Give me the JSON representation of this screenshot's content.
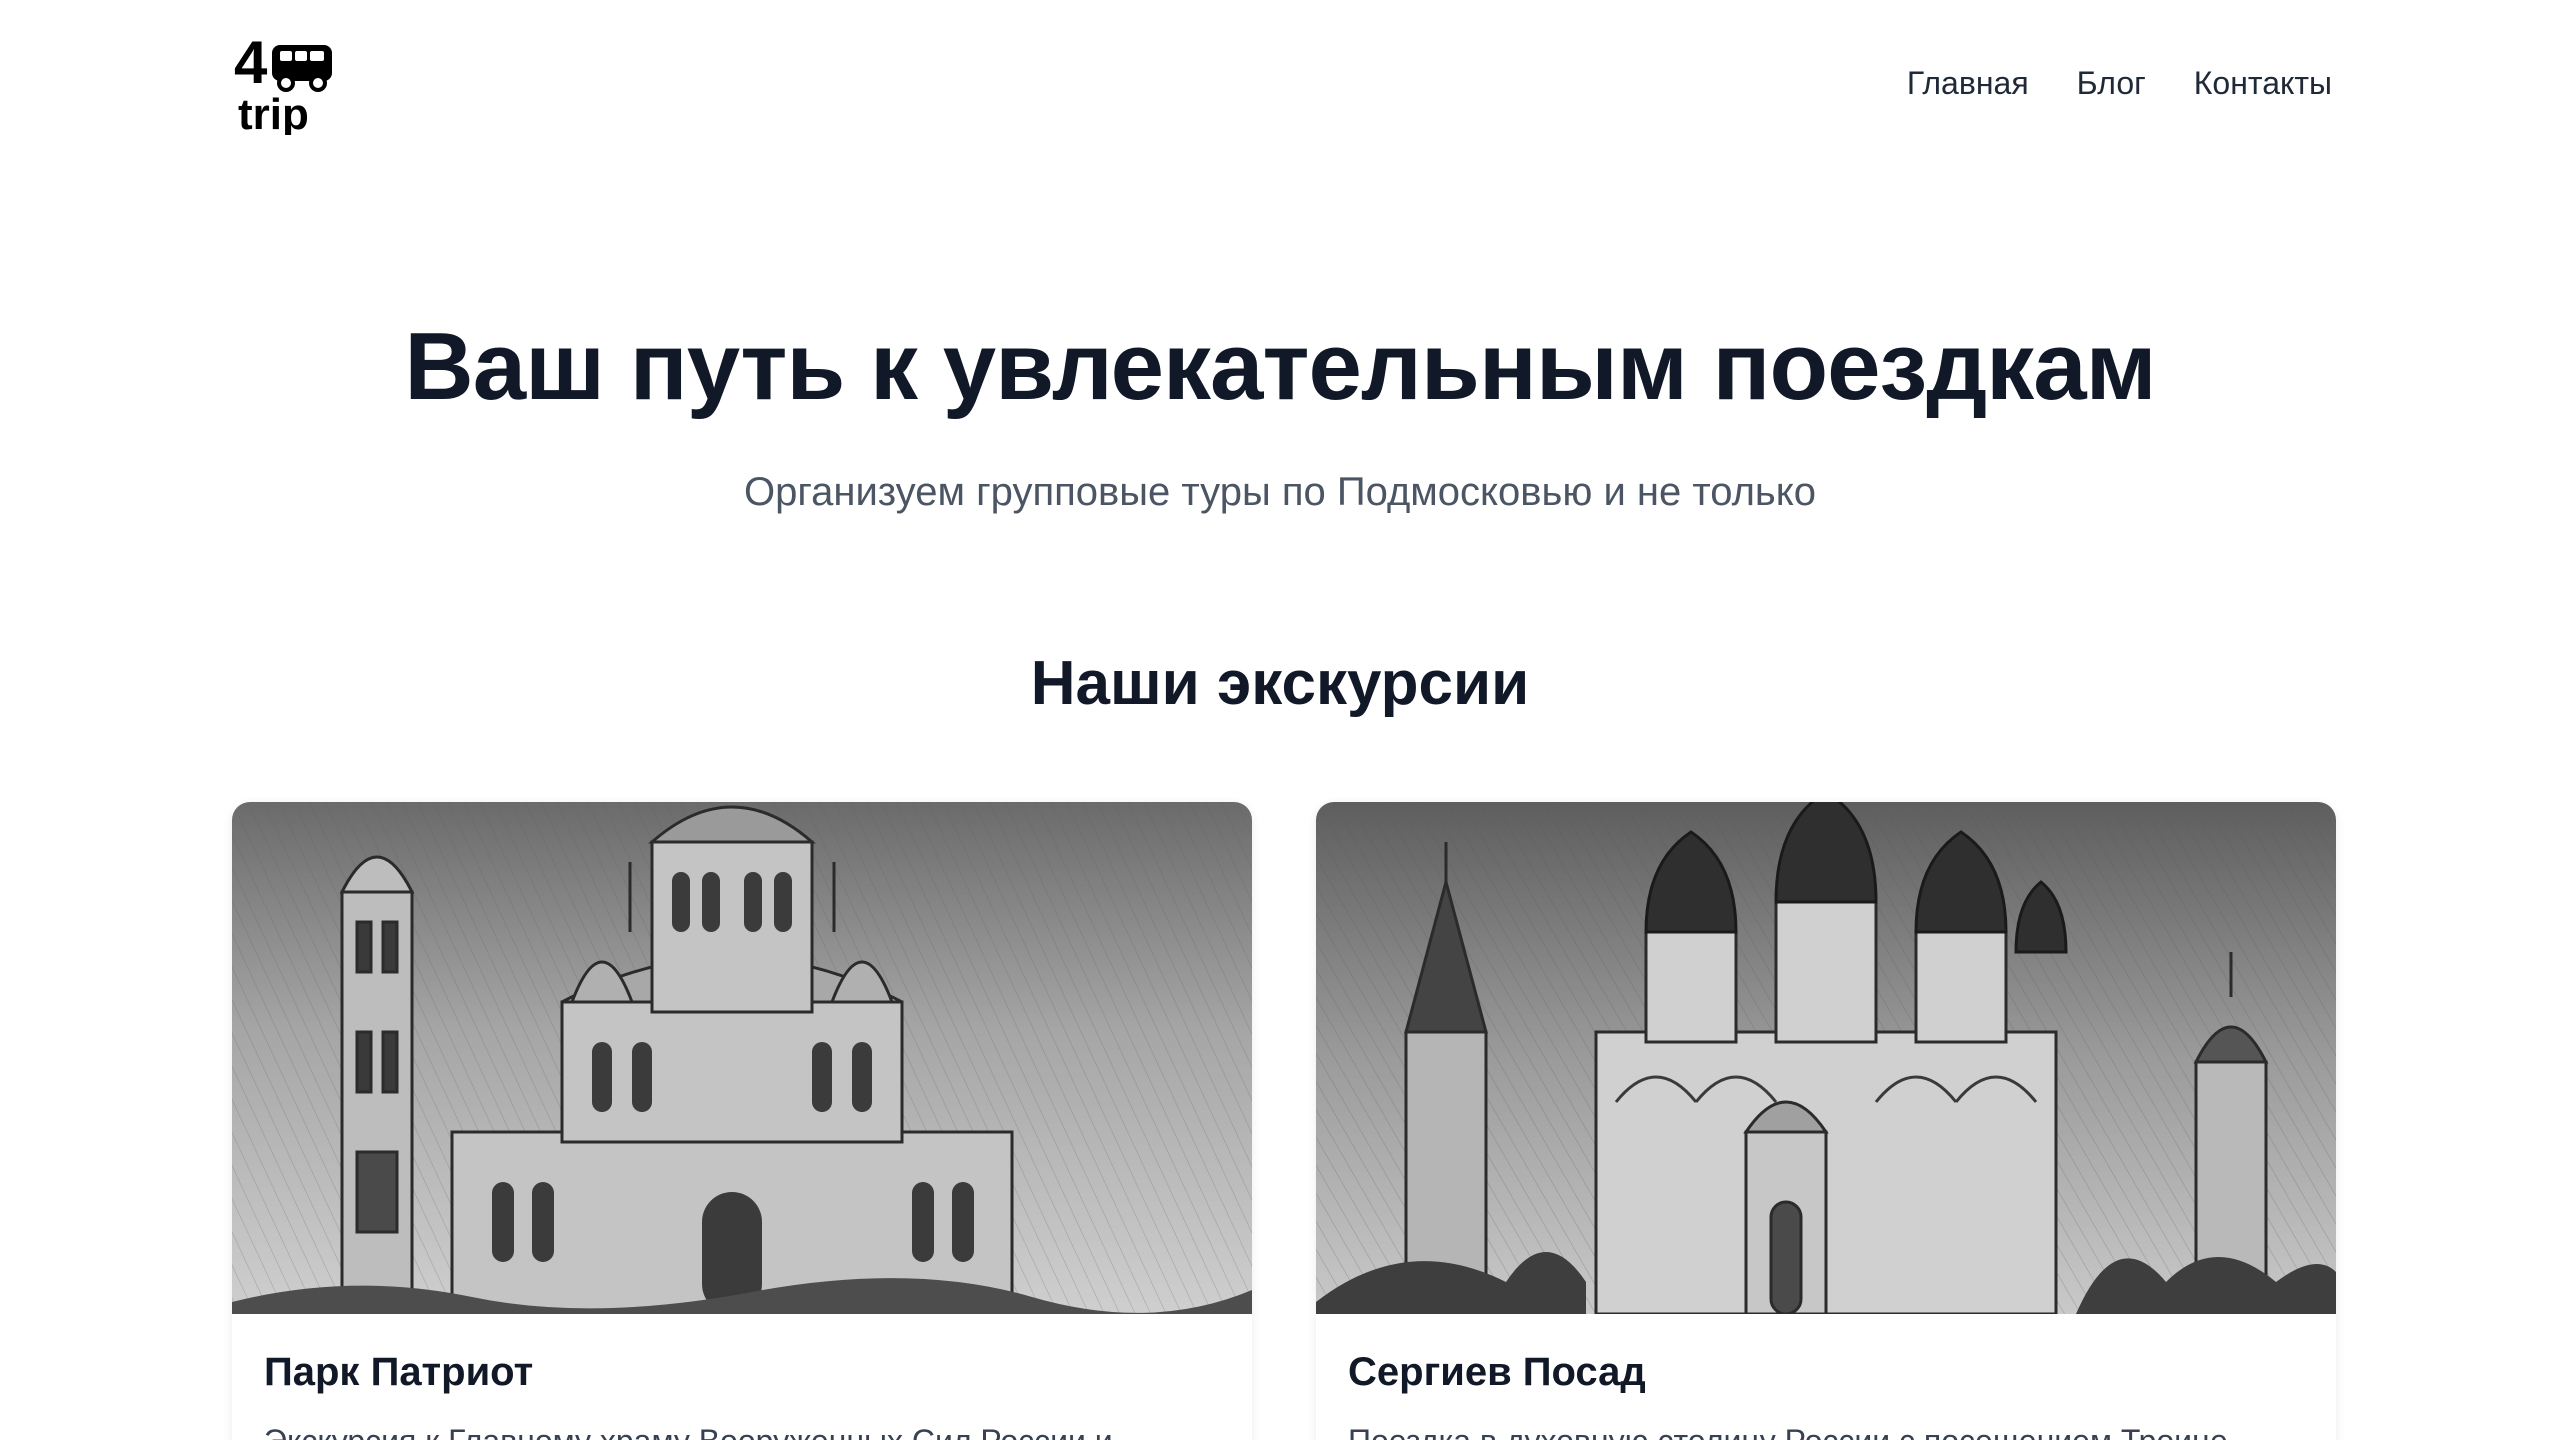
{
  "header": {
    "logo": {
      "number": "4",
      "text": "trip",
      "icon": "bus-icon"
    },
    "nav": [
      {
        "label": "Главная"
      },
      {
        "label": "Блог"
      },
      {
        "label": "Контакты"
      }
    ]
  },
  "hero": {
    "title": "Ваш путь к увлекательным поездкам",
    "subtitle": "Организуем групповые туры по Подмосковью и не только"
  },
  "excursions": {
    "section_title": "Наши экскурсии",
    "cards": [
      {
        "title": "Парк Патриот",
        "description": "Экскурсия к Главному храму Вооруженных Сил России и",
        "image": "cathedral-sketch"
      },
      {
        "title": "Сергиев Посад",
        "description": "Поездка в духовную столицу России с посещением Троице",
        "image": "monastery-sketch"
      }
    ]
  },
  "colors": {
    "text_primary": "#111827",
    "text_secondary": "#4b5563",
    "background": "#ffffff"
  }
}
